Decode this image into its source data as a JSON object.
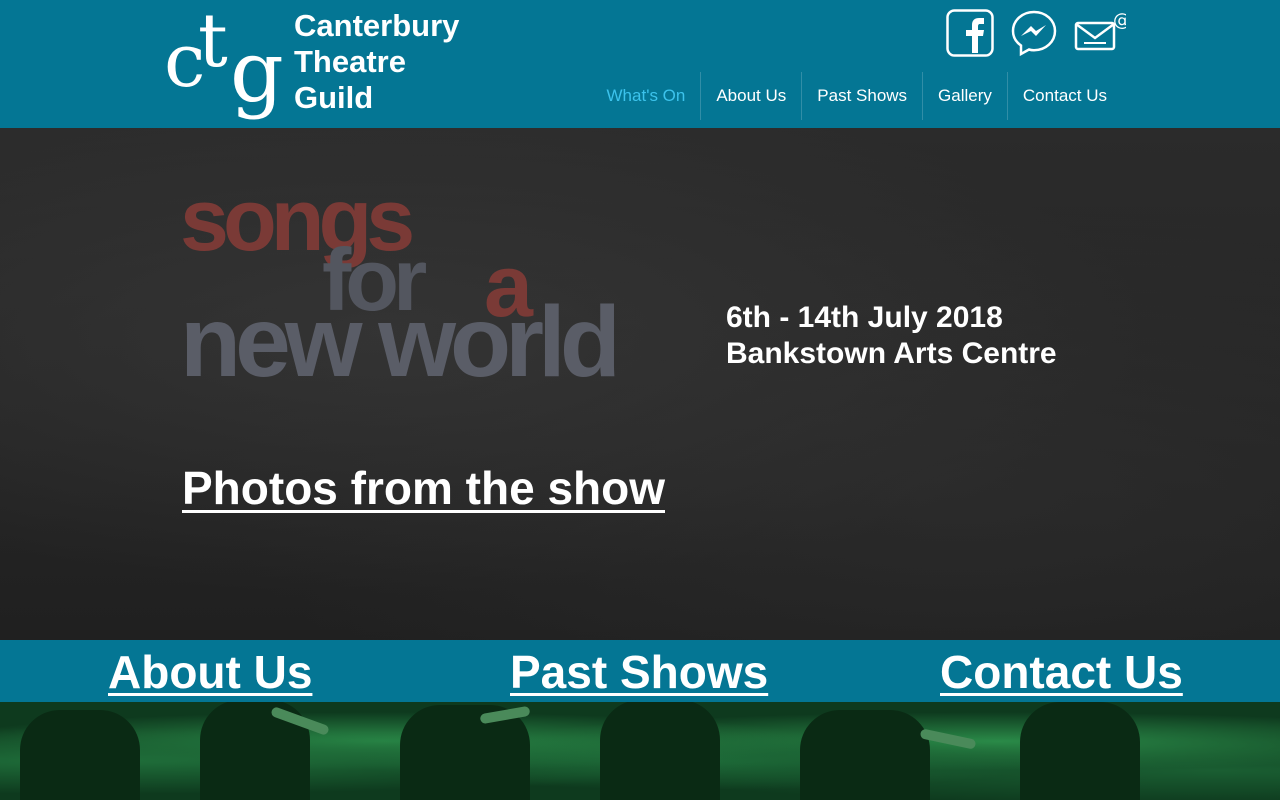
{
  "header": {
    "logo_mark": {
      "c": "c",
      "t": "t",
      "g": "g"
    },
    "logo_lines": [
      "Canterbury",
      "Theatre",
      "Guild"
    ],
    "social": [
      {
        "name": "facebook-icon"
      },
      {
        "name": "messenger-icon"
      },
      {
        "name": "email-icon"
      }
    ],
    "nav": [
      {
        "label": "What's On",
        "active": true
      },
      {
        "label": "About Us",
        "active": false
      },
      {
        "label": "Past Shows",
        "active": false
      },
      {
        "label": "Gallery",
        "active": false
      },
      {
        "label": "Contact Us",
        "active": false
      }
    ]
  },
  "hero": {
    "title_parts": {
      "songs": "songs",
      "for": "for",
      "a": "a",
      "new_world": "new world"
    },
    "dates": "6th - 14th July 2018",
    "venue": "Bankstown Arts Centre",
    "photos_link": "Photos from the show"
  },
  "linkbar": {
    "about": "About Us",
    "past": "Past Shows",
    "contact": "Contact Us"
  },
  "colors": {
    "header_bg": "#047694",
    "nav_active": "#3cc3ec",
    "title_red": "#7a3a36",
    "title_grey": "#5a5d67"
  }
}
